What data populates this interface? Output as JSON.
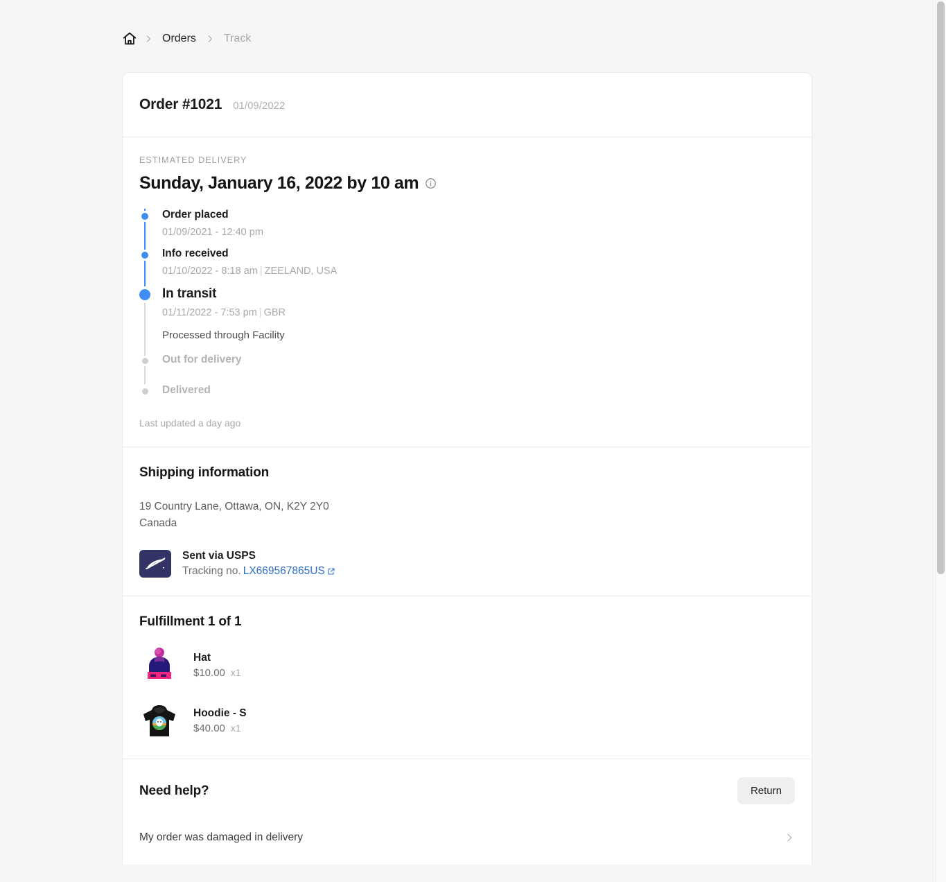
{
  "breadcrumb": {
    "home_icon": "home-icon",
    "items": [
      {
        "label": "Orders",
        "muted": false
      },
      {
        "label": "Track",
        "muted": true
      }
    ]
  },
  "order": {
    "title": "Order #1021",
    "date": "01/09/2022"
  },
  "delivery": {
    "eyebrow": "ESTIMATED DELIVERY",
    "estimate": "Sunday, January 16, 2022 by 10 am",
    "info_icon": "info-circle-icon",
    "last_updated": "Last updated a day ago",
    "steps": [
      {
        "title": "Order placed",
        "meta": "01/09/2021 - 12:40 pm",
        "location": "",
        "note": "",
        "state": "complete"
      },
      {
        "title": "Info received",
        "meta": "01/10/2022 - 8:18 am",
        "location": "ZEELAND, USA",
        "note": "",
        "state": "complete"
      },
      {
        "title": "In transit",
        "meta": "01/11/2022 - 7:53 pm",
        "location": "GBR",
        "note": "Processed through Facility",
        "state": "current"
      },
      {
        "title": "Out for delivery",
        "meta": "",
        "location": "",
        "note": "",
        "state": "pending"
      },
      {
        "title": "Delivered",
        "meta": "",
        "location": "",
        "note": "",
        "state": "pending"
      }
    ]
  },
  "shipping": {
    "title": "Shipping information",
    "address_line1": "19 Country Lane, Ottawa, ON, K2Y 2Y0",
    "address_line2": "Canada",
    "carrier_logo": "usps-logo-icon",
    "carrier_name": "Sent via USPS",
    "tracking_label": "Tracking no.",
    "tracking_number": "LX669567865US",
    "external_link_icon": "external-link-icon"
  },
  "fulfillment": {
    "title": "Fulfillment 1 of 1",
    "items": [
      {
        "name": "Hat",
        "price": "$10.00",
        "qty": "x1",
        "thumb": "beanie-hat-thumbnail"
      },
      {
        "name": "Hoodie - S",
        "price": "$40.00",
        "qty": "x1",
        "thumb": "black-hoodie-thumbnail"
      }
    ]
  },
  "help": {
    "title": "Need help?",
    "return_label": "Return",
    "rows": [
      {
        "label": "My order was damaged in delivery",
        "chevron": "chevron-right-icon"
      }
    ]
  },
  "colors": {
    "accent_blue": "#2c6ecb",
    "timeline_blue": "#3d8df5",
    "timeline_gray": "#d9d9d9",
    "page_bg": "#f6f6f7"
  }
}
